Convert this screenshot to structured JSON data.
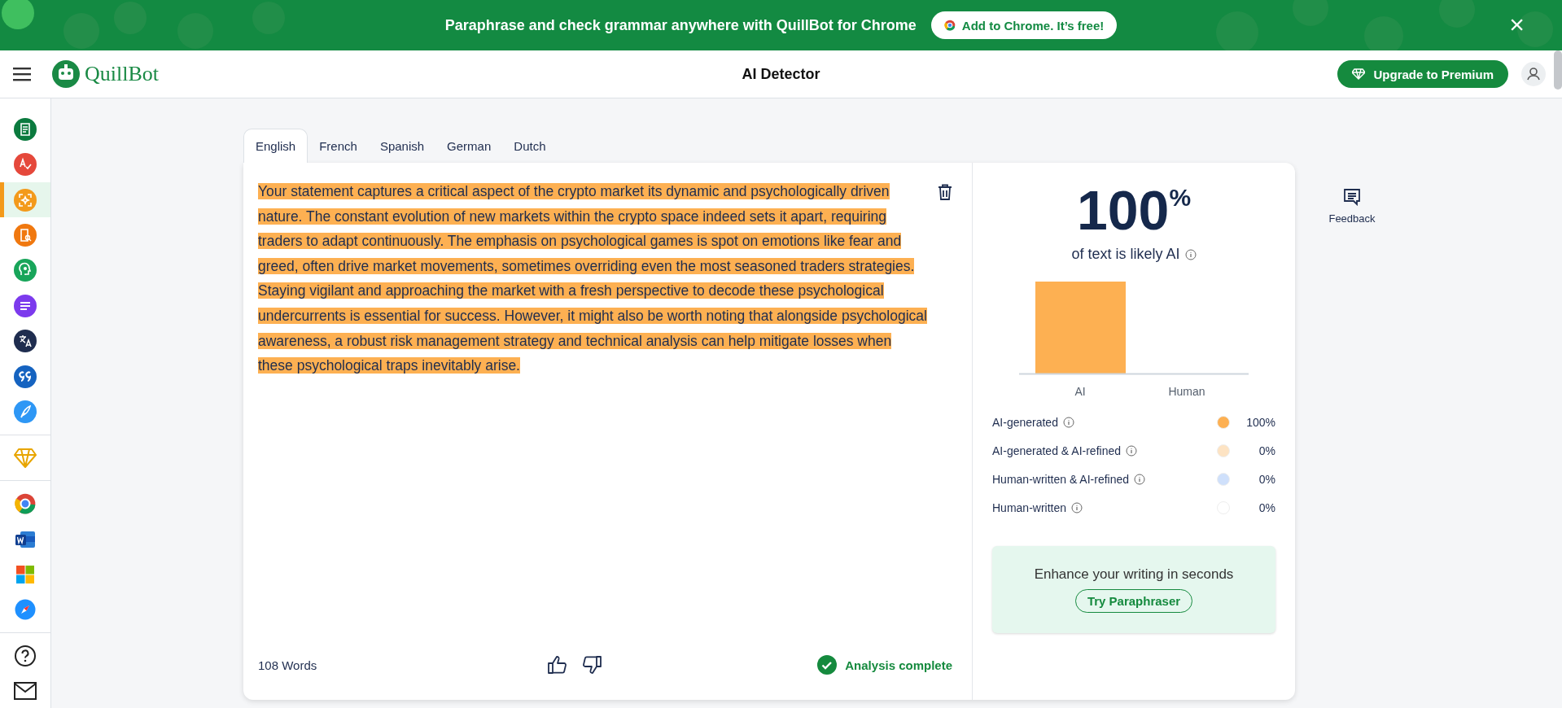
{
  "banner": {
    "message": "Paraphrase and check grammar anywhere with QuillBot for Chrome",
    "cta": "Add to Chrome. It’s free!",
    "close": "×"
  },
  "header": {
    "brand": "QuillBot",
    "title": "AI Detector",
    "upgrade": "Upgrade to Premium"
  },
  "sidebar": {
    "tools": [
      {
        "selected": false
      },
      {
        "selected": false
      },
      {
        "selected": true
      },
      {
        "selected": false
      },
      {
        "selected": false
      },
      {
        "selected": false
      },
      {
        "selected": false
      },
      {
        "selected": false
      },
      {
        "selected": false
      }
    ]
  },
  "tabs": [
    {
      "label": "English",
      "selected": true
    },
    {
      "label": "French",
      "selected": false
    },
    {
      "label": "Spanish",
      "selected": false
    },
    {
      "label": "German",
      "selected": false
    },
    {
      "label": "Dutch",
      "selected": false
    }
  ],
  "editor": {
    "text": "Your statement captures a critical aspect of the crypto market its dynamic and psychologically driven nature. The constant evolution of new markets within the crypto space indeed sets it apart, requiring traders to adapt continuously. The emphasis on psychological games is spot on emotions like fear and greed, often drive market movements, sometimes overriding even the most seasoned traders strategies. Staying vigilant and approaching the market with a fresh perspective to decode these psychological undercurrents is essential for success. However, it might also be worth noting that alongside psychological awareness, a robust risk management strategy and technical analysis can help mitigate losses when these psychological traps inevitably arise.",
    "word_count": "108 Words",
    "status": "Analysis complete"
  },
  "result": {
    "score": "100",
    "unit": "%",
    "caption": "of text is likely AI",
    "chart_labels": [
      "AI",
      "Human"
    ],
    "breakdown": [
      {
        "label": "AI-generated",
        "value": "100%",
        "color": "#fdb052"
      },
      {
        "label": "AI-generated & AI-refined",
        "value": "0%",
        "color": "#fde3c3"
      },
      {
        "label": "Human-written & AI-refined",
        "value": "0%",
        "color": "#cfe0fb"
      },
      {
        "label": "Human-written",
        "value": "0%",
        "color": "#ffffff"
      }
    ],
    "promo": {
      "text": "Enhance your writing in seconds",
      "button": "Try Paraphraser"
    }
  },
  "feedback": {
    "label": "Feedback"
  }
}
